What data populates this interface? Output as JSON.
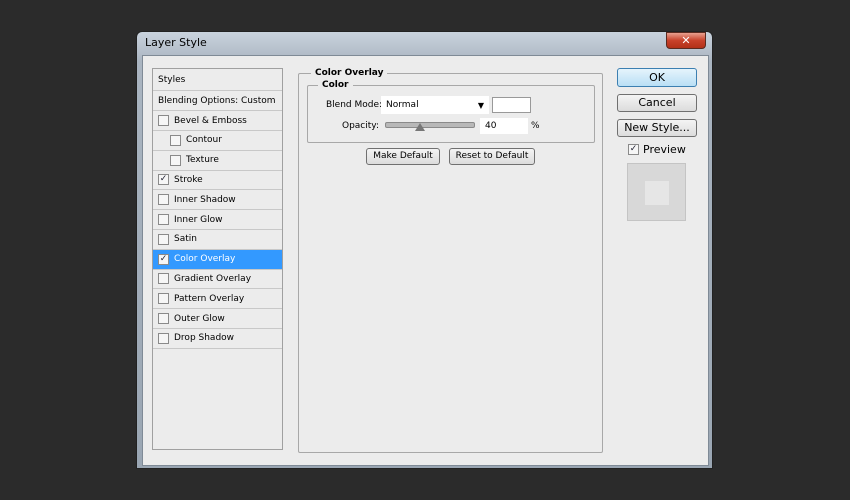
{
  "window": {
    "title": "Layer Style",
    "close": "✕"
  },
  "sidebar": {
    "header": "Styles",
    "blending": "Blending Options: Custom",
    "items": [
      {
        "label": "Bevel & Emboss",
        "checked": false,
        "indent": false
      },
      {
        "label": "Contour",
        "checked": false,
        "indent": true
      },
      {
        "label": "Texture",
        "checked": false,
        "indent": true
      },
      {
        "label": "Stroke",
        "checked": true,
        "indent": false
      },
      {
        "label": "Inner Shadow",
        "checked": false,
        "indent": false
      },
      {
        "label": "Inner Glow",
        "checked": false,
        "indent": false
      },
      {
        "label": "Satin",
        "checked": false,
        "indent": false
      },
      {
        "label": "Color Overlay",
        "checked": true,
        "indent": false,
        "selected": true
      },
      {
        "label": "Gradient Overlay",
        "checked": false,
        "indent": false
      },
      {
        "label": "Pattern Overlay",
        "checked": false,
        "indent": false
      },
      {
        "label": "Outer Glow",
        "checked": false,
        "indent": false
      },
      {
        "label": "Drop Shadow",
        "checked": false,
        "indent": false
      }
    ]
  },
  "panel": {
    "title": "Color Overlay",
    "group": "Color",
    "blend_label": "Blend Mode:",
    "blend_value": "Normal",
    "overlay_color": "#ffffff",
    "opacity_label": "Opacity:",
    "opacity_value": "40",
    "opacity_unit": "%",
    "opacity_percent": 40,
    "make_default": "Make Default",
    "reset_default": "Reset to Default"
  },
  "buttons": {
    "ok": "OK",
    "cancel": "Cancel",
    "new_style": "New Style..."
  },
  "preview": {
    "label": "Preview",
    "checked": true
  },
  "colors": {
    "selection": "#3399ff",
    "close": "#c8412a"
  }
}
